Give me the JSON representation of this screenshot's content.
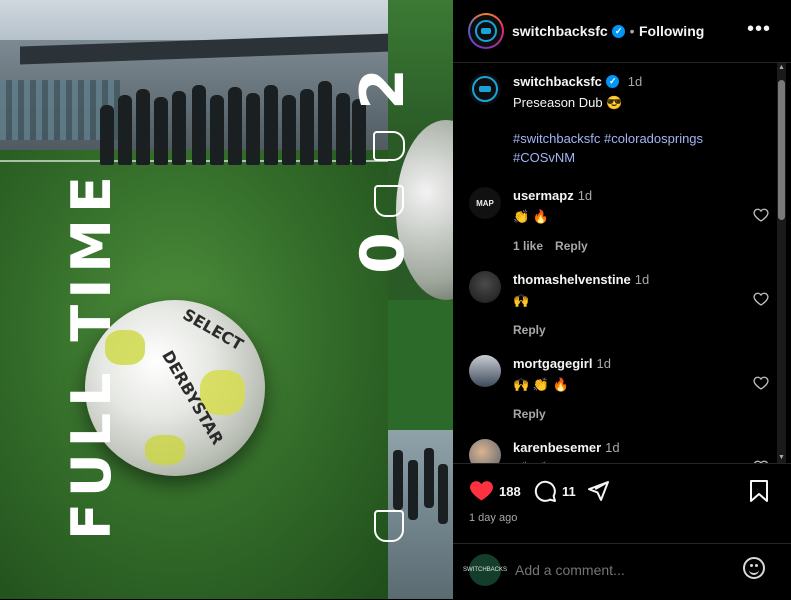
{
  "post": {
    "username": "switchbacksfc",
    "follow_status": "Following",
    "separator": "•",
    "more_label": "•••",
    "image_text": {
      "headline": "FULL TIME",
      "score_home": "2",
      "score_away": "0",
      "ball_brand": "DERBYSTAR",
      "ball_brand2": "SELECT"
    }
  },
  "caption": {
    "username": "switchbacksfc",
    "time": "1d",
    "text": "Preseason Dub 😎",
    "hashtags_line1": "#switchbacksfc #coloradosprings",
    "hashtags_line2": "#COSvNM"
  },
  "comments": [
    {
      "username": "usermapz",
      "time": "1d",
      "text": "👏 🔥",
      "likes": "1 like",
      "reply": "Reply",
      "avatar_label": "MAP"
    },
    {
      "username": "thomashelvenstine",
      "time": "1d",
      "text": "🙌",
      "reply": "Reply"
    },
    {
      "username": "mortgagegirl",
      "time": "1d",
      "text": "🙌 👏 🔥",
      "reply": "Reply"
    },
    {
      "username": "karenbesemer",
      "time": "1d",
      "text": "👏 👏"
    }
  ],
  "actions": {
    "like_count": "188",
    "comment_count": "11",
    "posted_ago": "1 day ago",
    "like_color": "#ff3040"
  },
  "add_comment": {
    "placeholder": "Add a comment...",
    "avatar_label": "SWITCHBACKS"
  },
  "colors": {
    "background": "#000000",
    "link": "#a3b4f5",
    "verified": "#0095f6",
    "muted": "#a8a8a8"
  }
}
